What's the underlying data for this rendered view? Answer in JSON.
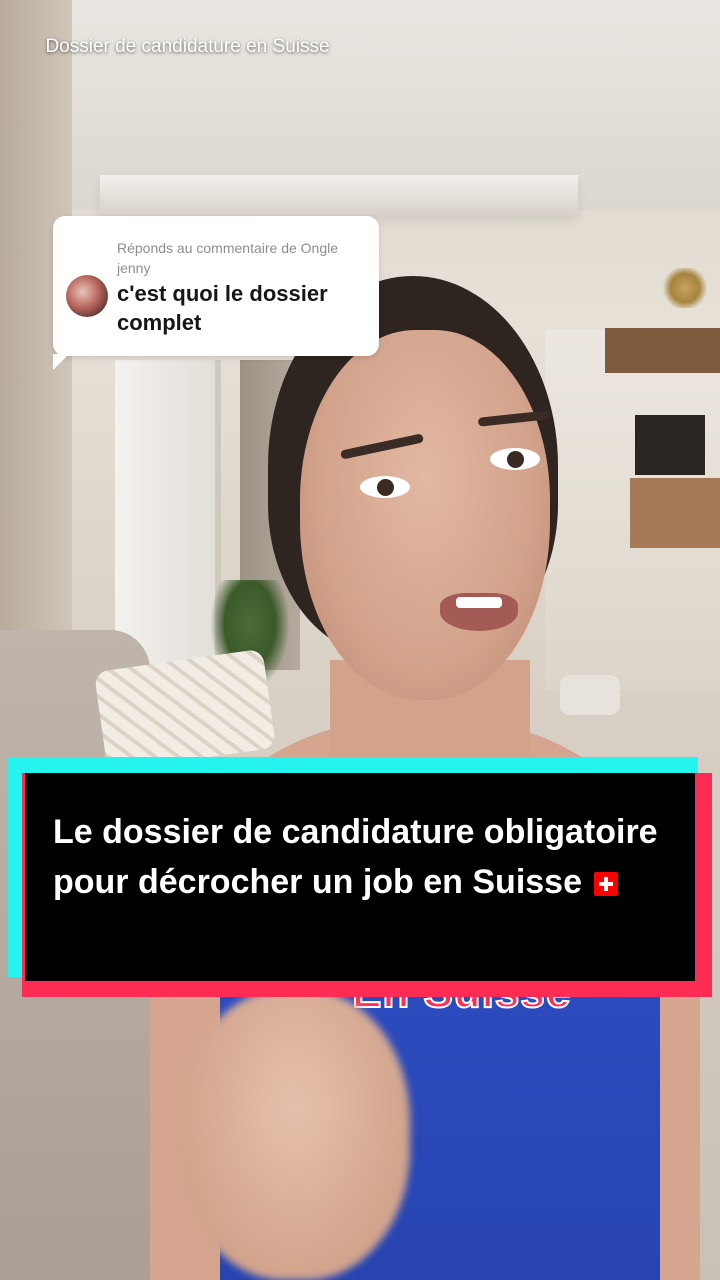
{
  "video": {
    "title": "Dossier de candidature en Suisse"
  },
  "reply_bubble": {
    "label": "Réponds au commentaire de Ongle jenny",
    "comment": "c'est quoi le dossier complet",
    "avatar_icon": "user-avatar"
  },
  "caption": {
    "text": "Le dossier de candidature obligatoire pour décrocher un job en Suisse",
    "flag_icon": "swiss-flag-icon",
    "colors": {
      "cyan": "#25f4ee",
      "red": "#fe2c55",
      "box": "#000000"
    }
  },
  "background_text": "En Suisse"
}
